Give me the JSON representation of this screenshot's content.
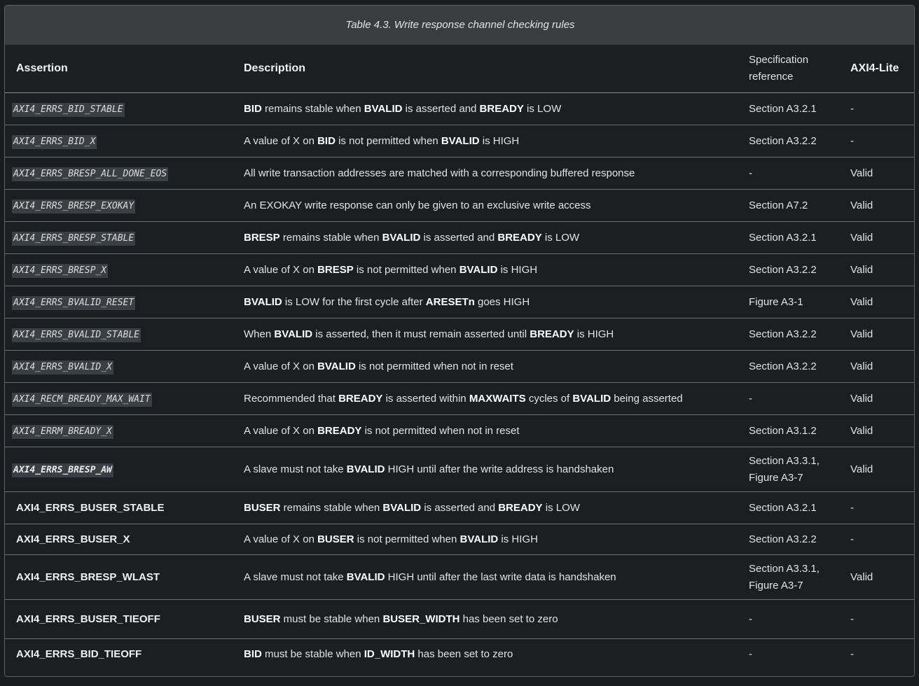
{
  "caption": "Table 4.3. Write response channel checking rules",
  "headers": {
    "assertion": "Assertion",
    "description": "Description",
    "spec_ref": "Specification reference",
    "axi4lite": "AXI4-Lite"
  },
  "rows": [
    {
      "assertion": "AXI4_ERRS_BID_STABLE",
      "style": "code",
      "desc": [
        {
          "b": "BID"
        },
        {
          "t": " remains stable when "
        },
        {
          "b": "BVALID"
        },
        {
          "t": " is asserted and "
        },
        {
          "b": "BREADY"
        },
        {
          "t": " is LOW"
        }
      ],
      "spec": "Section A3.2.1",
      "lite": "-"
    },
    {
      "assertion": "AXI4_ERRS_BID_X",
      "style": "code",
      "desc": [
        {
          "t": "A value of X on "
        },
        {
          "b": "BID"
        },
        {
          "t": " is not permitted when "
        },
        {
          "b": "BVALID"
        },
        {
          "t": " is HIGH"
        }
      ],
      "spec": "Section A3.2.2",
      "lite": "-"
    },
    {
      "assertion": "AXI4_ERRS_BRESP_ALL_DONE_EOS",
      "style": "code",
      "desc": [
        {
          "t": "All write transaction addresses are matched with a corresponding buffered response"
        }
      ],
      "spec": "-",
      "lite": "Valid"
    },
    {
      "assertion": "AXI4_ERRS_BRESP_EXOKAY",
      "style": "code",
      "desc": [
        {
          "t": "An EXOKAY write response can only be given to an exclusive write access"
        }
      ],
      "spec": "Section A7.2",
      "lite": "Valid"
    },
    {
      "assertion": "AXI4_ERRS_BRESP_STABLE",
      "style": "code",
      "desc": [
        {
          "b": "BRESP"
        },
        {
          "t": " remains stable when "
        },
        {
          "b": "BVALID"
        },
        {
          "t": " is asserted and "
        },
        {
          "b": "BREADY"
        },
        {
          "t": " is LOW"
        }
      ],
      "spec": "Section A3.2.1",
      "lite": "Valid"
    },
    {
      "assertion": "AXI4_ERRS_BRESP_X",
      "style": "code",
      "desc": [
        {
          "t": "A value of X on "
        },
        {
          "b": "BRESP"
        },
        {
          "t": " is not permitted when "
        },
        {
          "b": "BVALID"
        },
        {
          "t": " is HIGH"
        }
      ],
      "spec": "Section A3.2.2",
      "lite": "Valid"
    },
    {
      "assertion": "AXI4_ERRS_BVALID_RESET",
      "style": "code",
      "desc": [
        {
          "b": "BVALID"
        },
        {
          "t": " is LOW for the first cycle after "
        },
        {
          "b": "ARESETn"
        },
        {
          "t": " goes HIGH"
        }
      ],
      "spec": "Figure A3-1",
      "lite": "Valid"
    },
    {
      "assertion": "AXI4_ERRS_BVALID_STABLE",
      "style": "code",
      "desc": [
        {
          "t": "When "
        },
        {
          "b": "BVALID"
        },
        {
          "t": " is asserted, then it must remain asserted until "
        },
        {
          "b": "BREADY"
        },
        {
          "t": " is HIGH"
        }
      ],
      "spec": "Section A3.2.2",
      "lite": "Valid"
    },
    {
      "assertion": "AXI4_ERRS_BVALID_X",
      "style": "code",
      "desc": [
        {
          "t": "A value of X on "
        },
        {
          "b": "BVALID"
        },
        {
          "t": " is not permitted when not in reset"
        }
      ],
      "spec": "Section A3.2.2",
      "lite": "Valid"
    },
    {
      "assertion": "AXI4_RECM_BREADY_MAX_WAIT",
      "style": "code",
      "desc": [
        {
          "t": "Recommended that "
        },
        {
          "b": "BREADY"
        },
        {
          "t": " is asserted within "
        },
        {
          "b": "MAXWAITS"
        },
        {
          "t": " cycles of "
        },
        {
          "b": "BVALID"
        },
        {
          "t": " being asserted"
        }
      ],
      "spec": "-",
      "lite": "Valid"
    },
    {
      "assertion": "AXI4_ERRM_BREADY_X",
      "style": "code",
      "desc": [
        {
          "t": "A value of X on "
        },
        {
          "b": "BREADY"
        },
        {
          "t": " is not permitted when not in reset"
        }
      ],
      "spec": "Section A3.1.2",
      "lite": "Valid"
    },
    {
      "assertion": "AXI4_ERRS_BRESP_AW",
      "style": "code-strong",
      "desc": [
        {
          "t": "A slave must not take "
        },
        {
          "b": "BVALID"
        },
        {
          "t": " HIGH until after the write address is handshaken"
        }
      ],
      "spec": "Section A3.3.1, Figure A3-7",
      "lite": "Valid"
    },
    {
      "assertion": "AXI4_ERRS_BUSER_STABLE",
      "style": "plain",
      "desc": [
        {
          "b": "BUSER"
        },
        {
          "t": " remains stable when "
        },
        {
          "b": "BVALID"
        },
        {
          "t": " is asserted and "
        },
        {
          "b": "BREADY"
        },
        {
          "t": " is LOW"
        }
      ],
      "spec": "Section A3.2.1",
      "lite": "-"
    },
    {
      "assertion": "AXI4_ERRS_BUSER_X",
      "style": "plain",
      "desc": [
        {
          "t": "A value of X on "
        },
        {
          "b": "BUSER"
        },
        {
          "t": " is not permitted when "
        },
        {
          "b": "BVALID"
        },
        {
          "t": " is HIGH"
        }
      ],
      "spec": "Section A3.2.2",
      "lite": "-"
    },
    {
      "assertion": "AXI4_ERRS_BRESP_WLAST",
      "style": "plain",
      "desc": [
        {
          "t": "A slave must not take "
        },
        {
          "b": "BVALID"
        },
        {
          "t": " HIGH until after the last write data is handshaken"
        }
      ],
      "spec": "Section A3.3.1, Figure A3-7",
      "lite": "Valid"
    },
    {
      "assertion": "AXI4_ERRS_BUSER_TIEOFF",
      "style": "plain",
      "desc": [
        {
          "b": "BUSER"
        },
        {
          "t": " must be stable when "
        },
        {
          "b": "BUSER_WIDTH"
        },
        {
          "t": " has been set to zero"
        }
      ],
      "spec": "-",
      "lite": "-"
    },
    {
      "assertion": "AXI4_ERRS_BID_TIEOFF",
      "style": "plain",
      "desc": [
        {
          "b": "BID"
        },
        {
          "t": " must be stable when "
        },
        {
          "b": "ID_WIDTH"
        },
        {
          "t": " has been set to zero"
        }
      ],
      "spec": "-",
      "lite": "-"
    }
  ]
}
